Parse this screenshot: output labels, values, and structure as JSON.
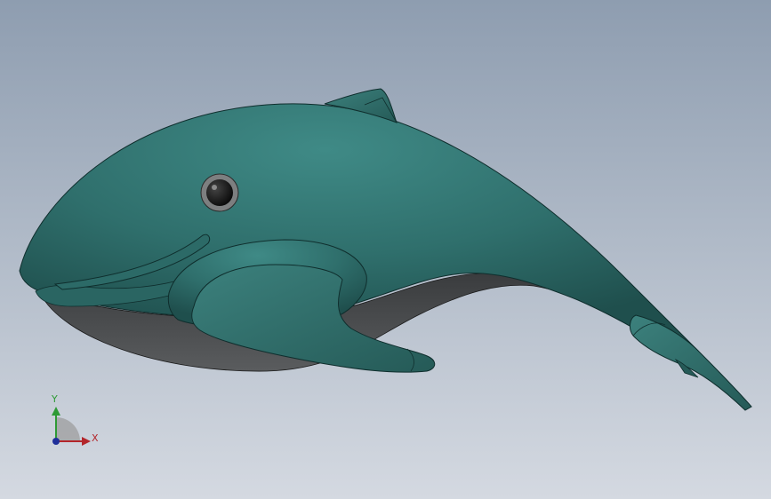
{
  "viewport": {
    "background_top": "#8e9db0",
    "background_bottom": "#d4d9e1"
  },
  "model": {
    "body_color": "#2f6f6c",
    "belly_color": "#4a4c4e",
    "eye_color": "#111111"
  },
  "triad": {
    "x_label": "X",
    "y_label": "Y",
    "x_color": "#b3262b",
    "y_color": "#2e9a35",
    "z_color": "#1f2f9a",
    "arrow_icons": [
      "x-axis-arrow-icon",
      "y-axis-arrow-icon",
      "z-axis-dot-icon"
    ]
  }
}
